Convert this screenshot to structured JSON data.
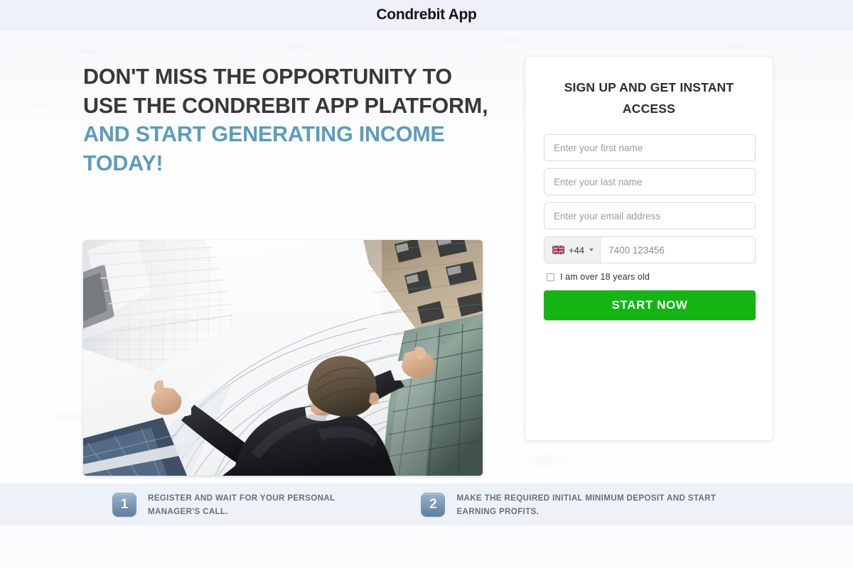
{
  "window": {
    "title": "Condrebit App"
  },
  "hero": {
    "headline_line1": "DON'T MISS THE OPPORTUNITY TO",
    "headline_line2": "USE THE CONDREBIT APP PLATFORM,",
    "headline_accent_line1": "AND START GENERATING INCOME",
    "headline_accent_line2": "TODAY!",
    "accent_color": "#5a9cbd",
    "heading_color": "#383838",
    "image_alt": "businessman-arms-raised-skyscrapers-photo"
  },
  "signup": {
    "title_line1": "SIGN UP AND GET INSTANT",
    "title_line2": "ACCESS",
    "first_name": {
      "placeholder": "Enter your first name",
      "value": ""
    },
    "last_name": {
      "placeholder": "Enter your last name",
      "value": ""
    },
    "email": {
      "placeholder": "Enter your email address",
      "value": ""
    },
    "phone": {
      "flag": "uk-flag-icon",
      "dial_code": "+44",
      "placeholder": "7400 123456",
      "value": ""
    },
    "age_consent": {
      "label": "I am over 18 years old",
      "checked": false
    },
    "submit_label": "START NOW",
    "submit_color": "#13b513"
  },
  "steps": [
    {
      "number": "1",
      "text_line1": "REGISTER AND WAIT FOR YOUR PERSONAL",
      "text_line2": "MANAGER'S CALL."
    },
    {
      "number": "2",
      "text_line1": "MAKE THE REQUIRED INITIAL MINIMUM DEPOSIT AND START",
      "text_line2": "EARNING PROFITS."
    }
  ],
  "colors": {
    "band_background": "#eef1f8",
    "titlebar_background": "#eef1f7",
    "badge_gradient_top": "#9ab4cc",
    "badge_gradient_bottom": "#5e7f9f"
  }
}
